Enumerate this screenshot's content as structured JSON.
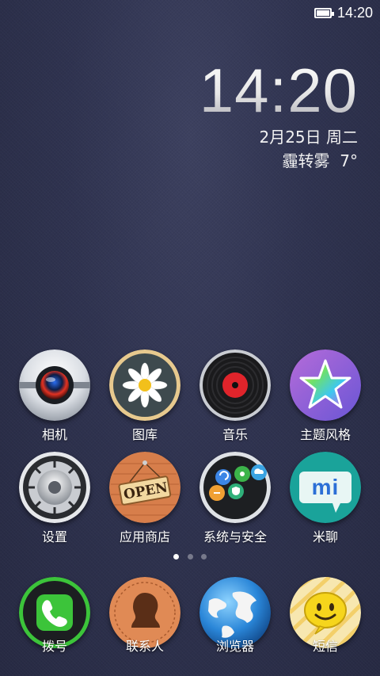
{
  "status_bar": {
    "battery_level": 1.0,
    "time": "14:20"
  },
  "clock": {
    "time": "14:20",
    "date": "2月25日 周二",
    "weather": "霾转雾",
    "temperature": "7°"
  },
  "apps_row1": [
    {
      "label": "相机",
      "icon": "camera-icon"
    },
    {
      "label": "图库",
      "icon": "gallery-icon"
    },
    {
      "label": "音乐",
      "icon": "music-icon"
    },
    {
      "label": "主题风格",
      "icon": "theme-icon"
    }
  ],
  "apps_row2": [
    {
      "label": "设置",
      "icon": "settings-icon"
    },
    {
      "label": "应用商店",
      "icon": "app-store-icon",
      "sign_text": "OPEN"
    },
    {
      "label": "系统与安全",
      "icon": "system-security-icon"
    },
    {
      "label": "米聊",
      "icon": "miliao-icon",
      "logo_text": "mi"
    }
  ],
  "page_indicator": {
    "pages": 3,
    "current": 1
  },
  "dock": [
    {
      "label": "拨号",
      "icon": "phone-icon"
    },
    {
      "label": "联系人",
      "icon": "contacts-icon"
    },
    {
      "label": "浏览器",
      "icon": "browser-icon"
    },
    {
      "label": "短信",
      "icon": "messaging-icon"
    }
  ],
  "colors": {
    "background": "#2f3350",
    "phone_green": "#3cc43a",
    "accent_red": "#e0242b",
    "miliao_teal": "#1aa39a"
  }
}
